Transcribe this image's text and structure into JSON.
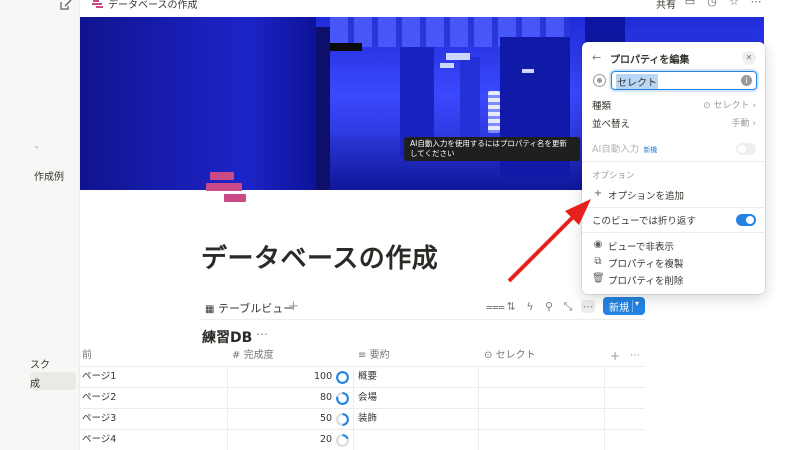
{
  "breadcrumb": {
    "title": "データベースの作成"
  },
  "topbar": {
    "share_label": "共有"
  },
  "sidebar": {
    "snippets": [
      "作成例",
      "スク",
      "成"
    ]
  },
  "tooltip": {
    "text": "AI自動入力を使用するにはプロパティ名を更新してください"
  },
  "page": {
    "title": "データベースの作成"
  },
  "view": {
    "tab_label": "テーブルビュー",
    "new_label": "新規"
  },
  "database": {
    "title": "練習DB",
    "columns": [
      "前",
      "完成度",
      "要約",
      "セレクト"
    ],
    "rows": [
      {
        "name": "ページ1",
        "progress": 100,
        "summary": "概要",
        "select": ""
      },
      {
        "name": "ページ2",
        "progress": 80,
        "summary": "会場",
        "select": ""
      },
      {
        "name": "ページ3",
        "progress": 50,
        "summary": "装飾",
        "select": ""
      },
      {
        "name": "ページ4",
        "progress": 20,
        "summary": "",
        "select": ""
      }
    ]
  },
  "panel": {
    "title": "プロパティを編集",
    "name_value": "セレクト",
    "type_label": "種類",
    "type_value": "セレクト",
    "sort_label": "並べ替え",
    "sort_value": "手動",
    "ai_label": "AI自動入力",
    "ai_badge": "新機",
    "options_header": "オプション",
    "add_option_label": "オプションを追加",
    "wrap_label": "このビューでは折り返す",
    "wrap_on": true,
    "hide_label": "ビューで非表示",
    "duplicate_label": "プロパティを複製",
    "delete_label": "プロパティを削除"
  },
  "colors": {
    "accent": "#2383e2",
    "page_icon": "#c94a86",
    "annotation_arrow": "#e8201c",
    "cover": "#0b11a5"
  }
}
